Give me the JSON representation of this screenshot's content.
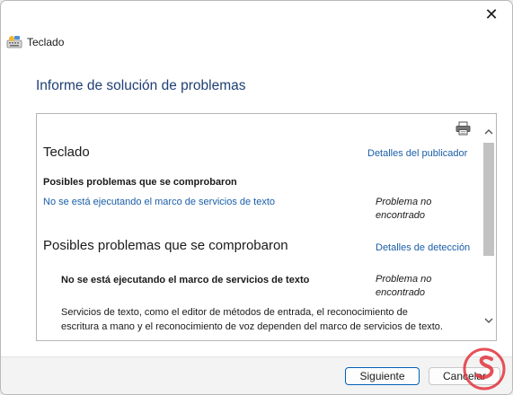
{
  "window": {
    "title": "Teclado",
    "close_glyph": "✕"
  },
  "report": {
    "heading": "Informe de solución de problemas",
    "section1": {
      "title": "Teclado",
      "publisher_link": "Detalles del publicador",
      "subheading": "Posibles problemas que se comprobaron",
      "issue_link": "No se está ejecutando el marco de servicios de texto",
      "issue_status": "Problema no encontrado"
    },
    "section2": {
      "title": "Posibles problemas que se comprobaron",
      "detection_link": "Detalles de detección",
      "issue_label": "No se está ejecutando el marco de servicios de texto",
      "issue_status": "Problema no encontrado",
      "description": "Servicios de texto, como el editor de métodos de entrada, el reconocimiento de escritura a mano y el reconocimiento de voz dependen del marco de servicios de texto."
    }
  },
  "footer": {
    "next_label": "Siguiente",
    "cancel_label": "Cancelar"
  },
  "watermark": {
    "text": "S"
  },
  "colors": {
    "link": "#1a5ea8",
    "heading": "#1f3f73",
    "primary_border": "#005fb8",
    "watermark": "#e2323b"
  },
  "icons": [
    "close-icon",
    "keyboard-app-icon",
    "printer-icon",
    "scroll-up-icon",
    "scroll-down-icon"
  ]
}
